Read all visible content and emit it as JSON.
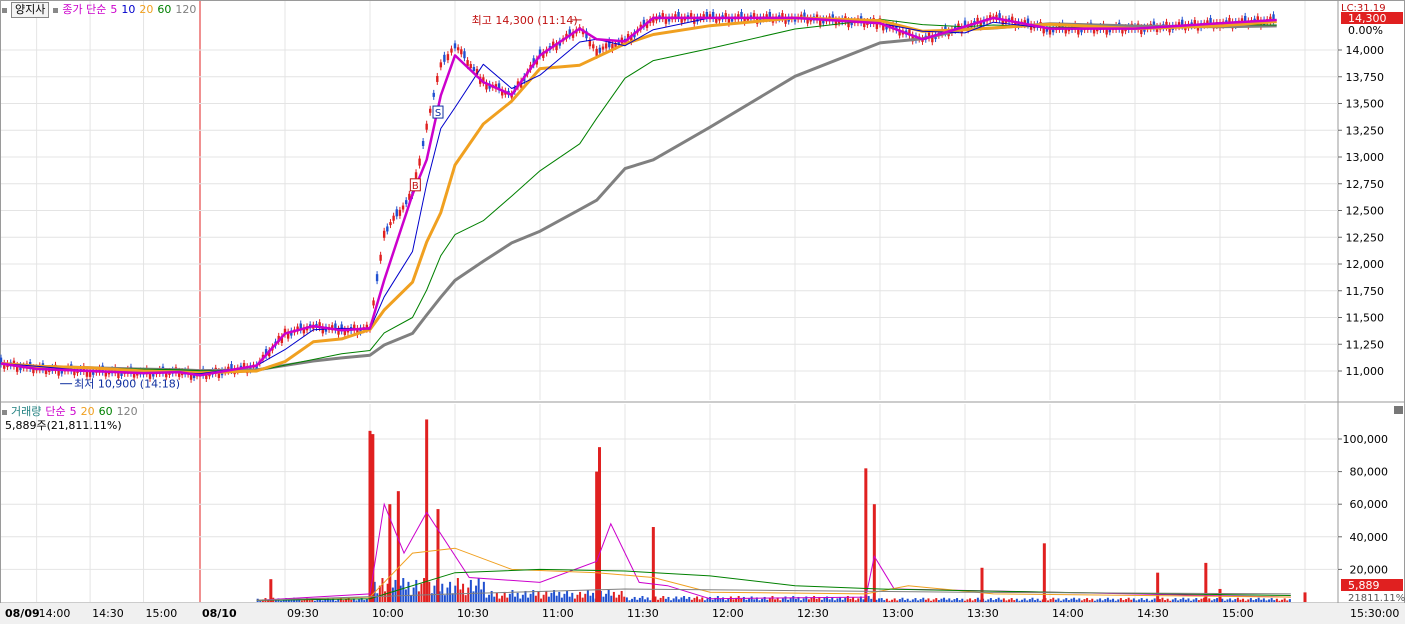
{
  "price_panel": {
    "symbol": "양지사",
    "ma_label": "종가 단순",
    "ma_periods": [
      "5",
      "10",
      "20",
      "60",
      "120"
    ],
    "high_annotation": "최고 14,300 (11:14)",
    "low_annotation": "최저 10,900 (14:18)",
    "marker_s": "S",
    "marker_b": "B",
    "y_ticks": [
      "14,000",
      "13,750",
      "13,500",
      "13,250",
      "13,000",
      "12,750",
      "12,500",
      "12,250",
      "12,000",
      "11,750",
      "11,500",
      "11,250",
      "11,000"
    ],
    "top_right_label": "LC:31.19",
    "current_price_badge": "14,300",
    "change_label": "0.00%"
  },
  "volume_panel": {
    "title": "거래량",
    "ma_label": "단순",
    "ma_periods": [
      "5",
      "20",
      "60",
      "120"
    ],
    "current_value": "5,889주(21,811.11%)",
    "y_ticks": [
      "100,000",
      "80,000",
      "60,000",
      "40,000",
      "20,000"
    ],
    "current_badge": "5,889",
    "ratio_badge": "21811.11%"
  },
  "x_axis": {
    "labels": [
      "08/09",
      "14:00",
      "14:30",
      "15:00",
      "08/10",
      "09:30",
      "10:00",
      "10:30",
      "11:00",
      "11:30",
      "12:00",
      "12:30",
      "13:00",
      "13:30",
      "14:00",
      "14:30",
      "15:00",
      "15:30:00"
    ]
  },
  "colors": {
    "ma5": "#cc00cc",
    "ma10": "#0000cc",
    "ma20": "#f0a020",
    "ma60": "#008000",
    "ma120": "#808080",
    "up": "#e02020",
    "down": "#2050d0",
    "grid": "#e4e4e4"
  },
  "chart_data": [
    {
      "type": "candlestick",
      "title": "양지사",
      "y_axis_range": [
        10900,
        14300
      ],
      "high": {
        "value": 14300,
        "time": "11:14"
      },
      "low": {
        "value": 10900,
        "time": "14:18"
      },
      "close_path": [
        {
          "x": "08/09 13:40",
          "y": 11070
        },
        {
          "x": "08/09 14:00",
          "y": 11020
        },
        {
          "x": "08/09 14:30",
          "y": 11000
        },
        {
          "x": "08/09 15:00",
          "y": 10980
        },
        {
          "x": "08/09 15:20",
          "y": 10990
        },
        {
          "x": "08/10 09:00",
          "y": 10960
        },
        {
          "x": "08/10 09:20",
          "y": 11050
        },
        {
          "x": "08/10 09:30",
          "y": 11350
        },
        {
          "x": "08/10 09:40",
          "y": 11420
        },
        {
          "x": "08/10 09:50",
          "y": 11380
        },
        {
          "x": "08/10 10:00",
          "y": 11400
        },
        {
          "x": "08/10 10:05",
          "y": 12300
        },
        {
          "x": "08/10 10:15",
          "y": 12650
        },
        {
          "x": "08/10 10:20",
          "y": 13300
        },
        {
          "x": "08/10 10:25",
          "y": 13850
        },
        {
          "x": "08/10 10:30",
          "y": 14050
        },
        {
          "x": "08/10 10:40",
          "y": 13700
        },
        {
          "x": "08/10 10:50",
          "y": 13580
        },
        {
          "x": "08/10 11:00",
          "y": 13950
        },
        {
          "x": "08/10 11:14",
          "y": 14200
        },
        {
          "x": "08/10 11:20",
          "y": 14000
        },
        {
          "x": "08/10 11:30",
          "y": 14080
        },
        {
          "x": "08/10 11:40",
          "y": 14300
        },
        {
          "x": "08/10 12:00",
          "y": 14300
        },
        {
          "x": "08/10 12:30",
          "y": 14300
        },
        {
          "x": "08/10 13:00",
          "y": 14250
        },
        {
          "x": "08/10 13:15",
          "y": 14100
        },
        {
          "x": "08/10 13:30",
          "y": 14220
        },
        {
          "x": "08/10 13:40",
          "y": 14300
        },
        {
          "x": "08/10 14:00",
          "y": 14200
        },
        {
          "x": "08/10 14:30",
          "y": 14200
        },
        {
          "x": "08/10 15:00",
          "y": 14250
        },
        {
          "x": "08/10 15:20",
          "y": 14280
        }
      ],
      "moving_averages": [
        {
          "name": "5",
          "color": "#cc00cc"
        },
        {
          "name": "10",
          "color": "#0000cc"
        },
        {
          "name": "20",
          "color": "#f0a020"
        },
        {
          "name": "60",
          "color": "#008000"
        },
        {
          "name": "120",
          "color": "#808080"
        }
      ]
    },
    {
      "type": "bar",
      "title": "거래량",
      "y_axis_range": [
        0,
        110000
      ],
      "bars": [
        {
          "x": "08/10 09:25",
          "y": 14000
        },
        {
          "x": "08/10 10:00",
          "y": 105000
        },
        {
          "x": "08/10 10:01",
          "y": 103000
        },
        {
          "x": "08/10 10:07",
          "y": 60000
        },
        {
          "x": "08/10 10:10",
          "y": 68000
        },
        {
          "x": "08/10 10:20",
          "y": 112000
        },
        {
          "x": "08/10 10:24",
          "y": 57000
        },
        {
          "x": "08/10 11:20",
          "y": 80000
        },
        {
          "x": "08/10 11:21",
          "y": 95000
        },
        {
          "x": "08/10 11:40",
          "y": 46000
        },
        {
          "x": "08/10 12:55",
          "y": 82000
        },
        {
          "x": "08/10 12:58",
          "y": 60000
        },
        {
          "x": "08/10 13:36",
          "y": 21000
        },
        {
          "x": "08/10 13:58",
          "y": 36000
        },
        {
          "x": "08/10 14:38",
          "y": 18000
        },
        {
          "x": "08/10 14:55",
          "y": 24000
        },
        {
          "x": "08/10 15:00",
          "y": 8000
        },
        {
          "x": "08/10 15:30",
          "y": 5889
        }
      ]
    }
  ]
}
